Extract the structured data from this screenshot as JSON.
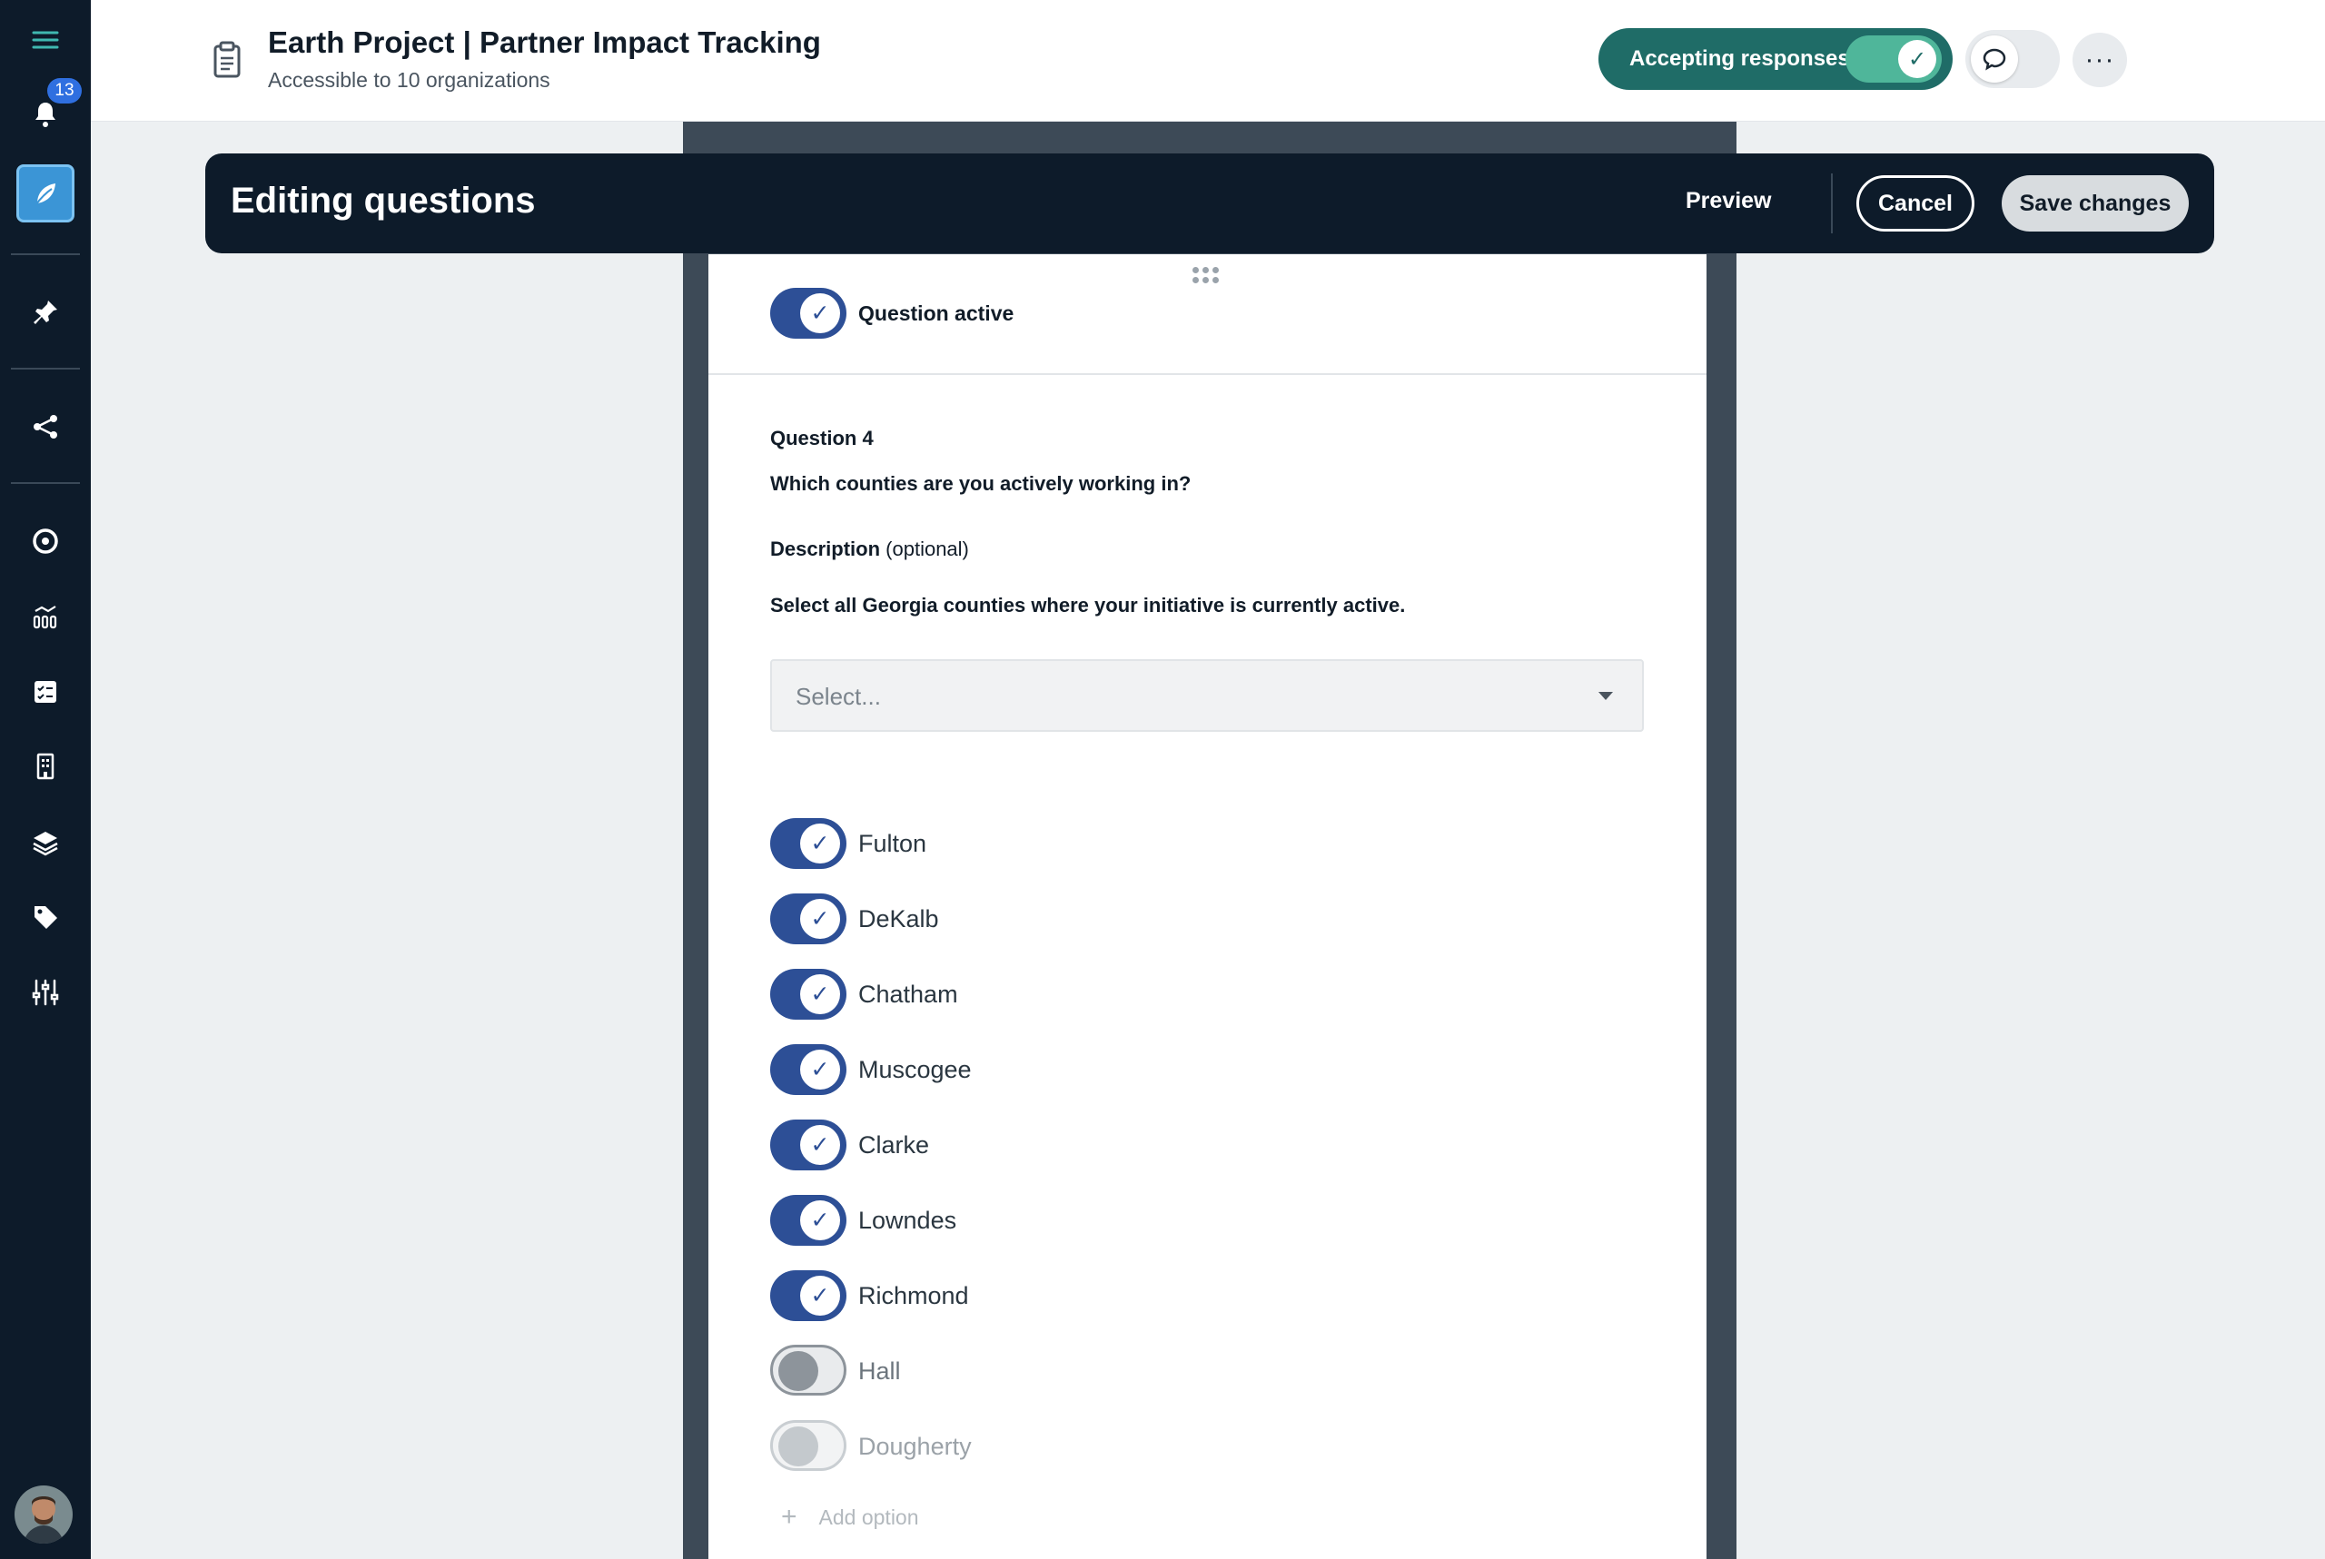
{
  "sidebar": {
    "notification_count": "13"
  },
  "header": {
    "title": "Earth Project | Partner Impact Tracking",
    "subtitle": "Accessible to 10 organizations",
    "accepting_label": "Accepting responses",
    "accepting_on": true,
    "comments_on": false,
    "more_label": "···"
  },
  "edit_bar": {
    "title": "Editing questions",
    "preview_label": "Preview",
    "cancel_label": "Cancel",
    "save_label": "Save changes"
  },
  "question": {
    "active_label": "Question active",
    "active": true,
    "number_label": "Question 4",
    "text": "Which counties are you actively working in?",
    "description_label": "Description",
    "description_optional": "(optional)",
    "description_text": "Select all Georgia counties where your initiative is currently active.",
    "select_placeholder": "Select...",
    "options": [
      {
        "label": "Fulton",
        "enabled": true
      },
      {
        "label": "DeKalb",
        "enabled": true
      },
      {
        "label": "Chatham",
        "enabled": true
      },
      {
        "label": "Muscogee",
        "enabled": true
      },
      {
        "label": "Clarke",
        "enabled": true
      },
      {
        "label": "Lowndes",
        "enabled": true
      },
      {
        "label": "Richmond",
        "enabled": true
      },
      {
        "label": "Hall",
        "enabled": false
      },
      {
        "label": "Dougherty",
        "enabled": false
      }
    ],
    "add_option_label": "Add option"
  },
  "colors": {
    "sidebar_bg": "#0d1b2a",
    "toggle_on": "#2d4f96",
    "accepting_bg": "#1f6c67",
    "accent_active": "#3b95d6"
  }
}
